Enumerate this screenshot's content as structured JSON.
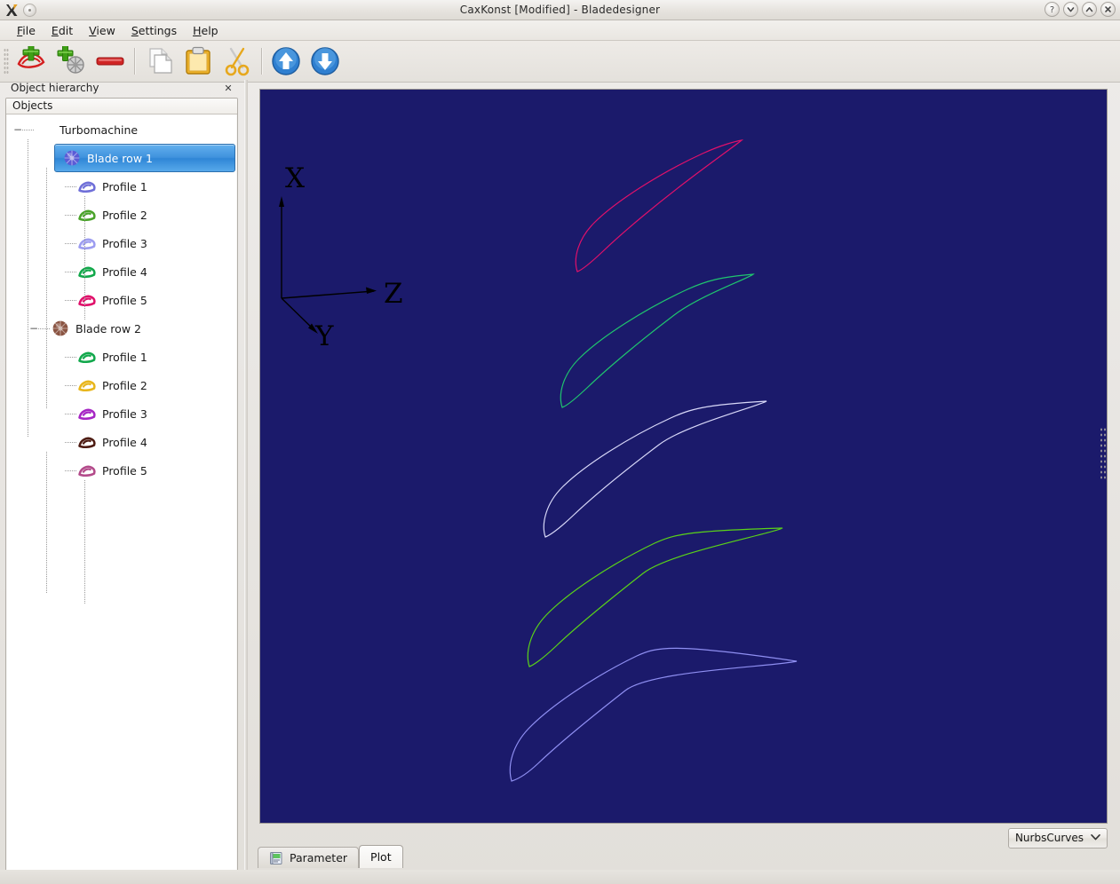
{
  "window": {
    "title": "CaxKonst [Modified] - Bladedesigner",
    "app_icon": "x-app-icon",
    "controls": [
      {
        "name": "help-button",
        "glyph": "?"
      },
      {
        "name": "minimize-button",
        "glyph": "v"
      },
      {
        "name": "maximize-button",
        "glyph": "^"
      },
      {
        "name": "close-button",
        "glyph": "x"
      }
    ]
  },
  "menubar": {
    "items": [
      {
        "name": "menu-file",
        "mnemonic": "F",
        "rest": "ile"
      },
      {
        "name": "menu-edit",
        "mnemonic": "E",
        "rest": "dit"
      },
      {
        "name": "menu-view",
        "mnemonic": "V",
        "rest": "iew"
      },
      {
        "name": "menu-settings",
        "mnemonic": "S",
        "rest": "ettings"
      },
      {
        "name": "menu-help",
        "mnemonic": "H",
        "rest": "elp"
      }
    ]
  },
  "toolbar": {
    "buttons": [
      {
        "name": "add-profile-button",
        "icon": "plus-profile-icon"
      },
      {
        "name": "add-blade-row-button",
        "icon": "plus-blade-row-icon"
      },
      {
        "name": "remove-button",
        "icon": "minus-icon"
      },
      {
        "name": "copy-button",
        "icon": "copy-icon"
      },
      {
        "name": "paste-button",
        "icon": "clipboard-icon"
      },
      {
        "name": "cut-button",
        "icon": "scissors-icon"
      },
      {
        "name": "move-up-button",
        "icon": "arrow-up-circle-icon"
      },
      {
        "name": "move-down-button",
        "icon": "arrow-down-circle-icon"
      }
    ]
  },
  "dock": {
    "title": "Object hierarchy",
    "close_glyph": "✕",
    "tree_header": "Objects"
  },
  "tree": {
    "nodes": [
      {
        "id": "turbomachine",
        "label": "Turbomachine",
        "depth": 0,
        "expander": "−",
        "icon": "none",
        "selected": false
      },
      {
        "id": "bladerow1",
        "label": "Blade row 1",
        "depth": 1,
        "expander": "−",
        "icon": "blade-row-icon",
        "icon_color": "#5b5bd6",
        "selected": true
      },
      {
        "id": "br1p1",
        "label": "Profile 1",
        "depth": 2,
        "expander": "",
        "icon": "profile-icon",
        "icon_color": "#6f6fd8",
        "selected": false
      },
      {
        "id": "br1p2",
        "label": "Profile 2",
        "depth": 2,
        "expander": "",
        "icon": "profile-icon",
        "icon_color": "#4aa32a",
        "selected": false
      },
      {
        "id": "br1p3",
        "label": "Profile 3",
        "depth": 2,
        "expander": "",
        "icon": "profile-icon",
        "icon_color": "#9c9cf0",
        "selected": false
      },
      {
        "id": "br1p4",
        "label": "Profile 4",
        "depth": 2,
        "expander": "",
        "icon": "profile-icon",
        "icon_color": "#11a84a",
        "selected": false
      },
      {
        "id": "br1p5",
        "label": "Profile 5",
        "depth": 2,
        "expander": "",
        "icon": "profile-icon",
        "icon_color": "#e0106a",
        "selected": false
      },
      {
        "id": "bladerow2",
        "label": "Blade row 2",
        "depth": 1,
        "expander": "−",
        "icon": "blade-row-icon",
        "icon_color": "#8a5442",
        "selected": false
      },
      {
        "id": "br2p1",
        "label": "Profile 1",
        "depth": 2,
        "expander": "",
        "icon": "profile-icon",
        "icon_color": "#12a84c",
        "selected": false
      },
      {
        "id": "br2p2",
        "label": "Profile 2",
        "depth": 2,
        "expander": "",
        "icon": "profile-icon",
        "icon_color": "#e8b61c",
        "selected": false
      },
      {
        "id": "br2p3",
        "label": "Profile 3",
        "depth": 2,
        "expander": "",
        "icon": "profile-icon",
        "icon_color": "#a626c4",
        "selected": false
      },
      {
        "id": "br2p4",
        "label": "Profile 4",
        "depth": 2,
        "expander": "",
        "icon": "profile-icon",
        "icon_color": "#4d1b12",
        "selected": false
      },
      {
        "id": "br2p5",
        "label": "Profile 5",
        "depth": 2,
        "expander": "",
        "icon": "profile-icon",
        "icon_color": "#b34a8a",
        "selected": false
      }
    ]
  },
  "plot": {
    "background_color": "#1b1a6b",
    "axis_triad": {
      "color": "#000000",
      "labels": {
        "x": "X",
        "y": "Y",
        "z": "Z"
      }
    },
    "curves": [
      {
        "name": "profile-curve-1",
        "color": "#e0106a"
      },
      {
        "name": "profile-curve-2",
        "color": "#1fc56e"
      },
      {
        "name": "profile-curve-3",
        "color": "#d8d8f8"
      },
      {
        "name": "profile-curve-4",
        "color": "#5ad318"
      },
      {
        "name": "profile-curve-5",
        "color": "#8f8ff2"
      }
    ],
    "curve_type_selector": {
      "value": "NurbsCurves",
      "caret": "⌄"
    }
  },
  "tabs": [
    {
      "name": "tab-parameter",
      "label": "Parameter",
      "icon": "notebook-icon",
      "active": false
    },
    {
      "name": "tab-plot",
      "label": "Plot",
      "icon": "none",
      "active": true
    }
  ]
}
